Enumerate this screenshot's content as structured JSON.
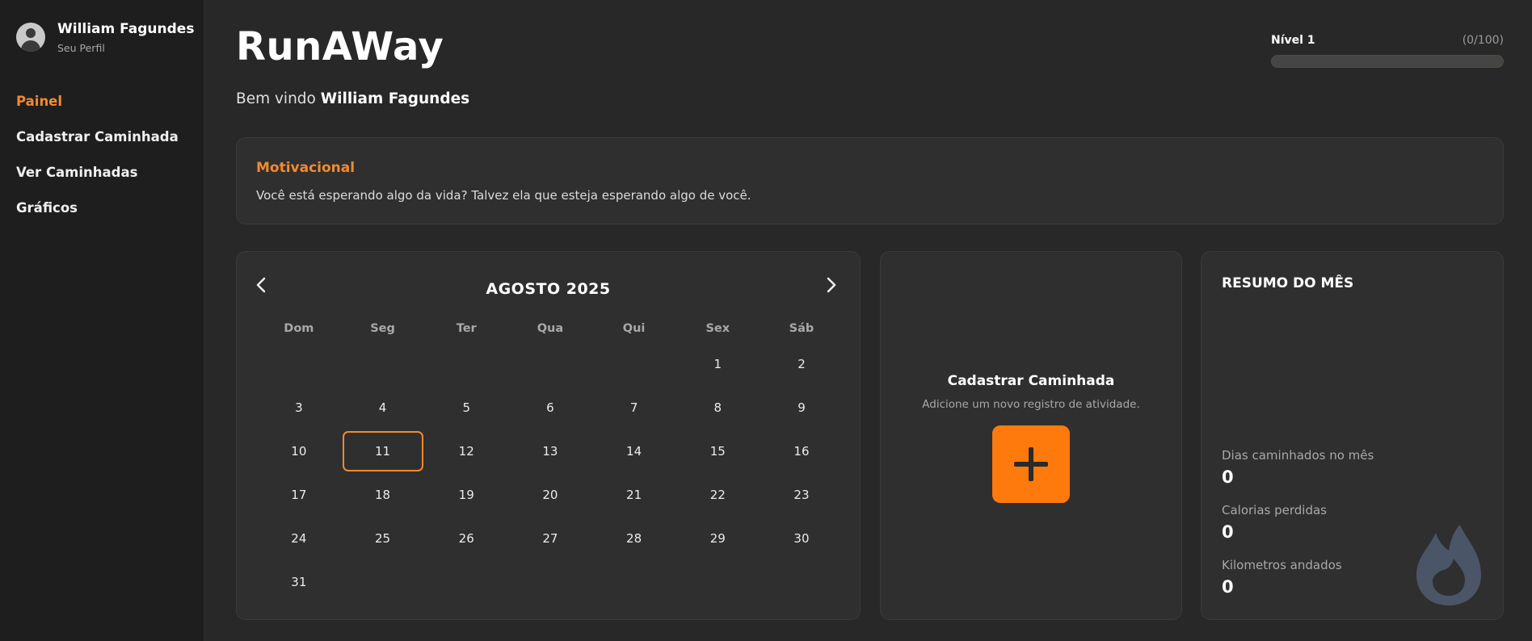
{
  "sidebar": {
    "profile_name": "William Fagundes",
    "profile_sub": "Seu Perfil",
    "nav": [
      "Painel",
      "Cadastrar Caminhada",
      "Ver Caminhadas",
      "Gráficos"
    ]
  },
  "header": {
    "title": "RunAWay",
    "welcome_prefix": "Bem vindo",
    "welcome_name": "William Fagundes"
  },
  "level": {
    "label": "Nível 1",
    "count": "(0/100)",
    "progress": 0
  },
  "motivational": {
    "title": "Motivacional",
    "text": "Você está esperando algo da vida? Talvez ela que esteja esperando algo de você."
  },
  "calendar": {
    "prev_icon": "chevron-left-icon",
    "next_icon": "chevron-right-icon",
    "title": "AGOSTO 2025",
    "weekdays": [
      "Dom",
      "Seg",
      "Ter",
      "Qua",
      "Qui",
      "Sex",
      "Sáb"
    ],
    "weeks": [
      [
        "",
        "",
        "",
        "",
        "",
        "1",
        "2"
      ],
      [
        "3",
        "4",
        "5",
        "6",
        "7",
        "8",
        "9"
      ],
      [
        "10",
        "11",
        "12",
        "13",
        "14",
        "15",
        "16"
      ],
      [
        "17",
        "18",
        "19",
        "20",
        "21",
        "22",
        "23"
      ],
      [
        "24",
        "25",
        "26",
        "27",
        "28",
        "29",
        "30"
      ],
      [
        "31",
        "",
        "",
        "",
        "",
        "",
        ""
      ]
    ],
    "today": "11"
  },
  "register": {
    "title": "Cadastrar Caminhada",
    "subtitle": "Adicione um novo registro de atividade.",
    "button_icon": "plus-icon"
  },
  "summary": {
    "title": "RESUMO DO MÊS",
    "stats": [
      {
        "label": "Dias caminhados no mês",
        "value": "0"
      },
      {
        "label": "Calorias perdidas",
        "value": "0"
      },
      {
        "label": "Kilometros andados",
        "value": "0"
      }
    ],
    "icon": "flame-icon"
  },
  "colors": {
    "accent": "#f28a2e",
    "button": "#ff7a0c",
    "flame": "#4a5568"
  }
}
